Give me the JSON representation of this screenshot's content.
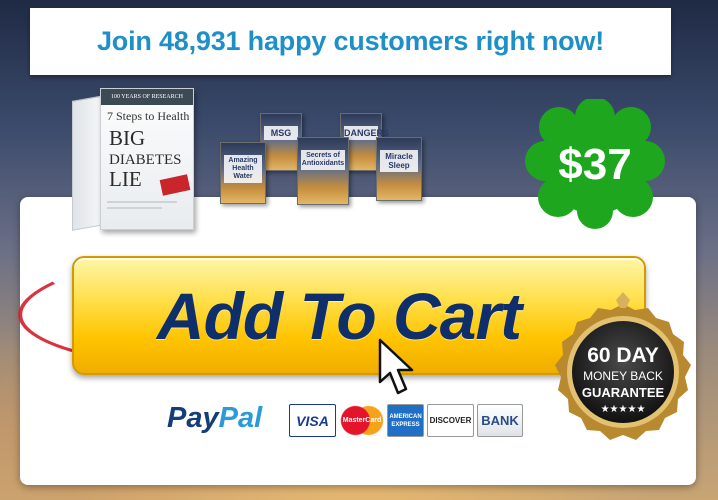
{
  "banner": {
    "text": "Join 48,931 happy customers right now!"
  },
  "main_product": {
    "band_text": "100 YEARS OF RESEARCH",
    "subtitle": "7 Steps to Health",
    "title_lines": [
      "BIG",
      "DIABETES",
      "LIE"
    ]
  },
  "bonus_books": [
    {
      "title": "MSG"
    },
    {
      "title": "DANGERS"
    },
    {
      "title": "Amazing Health Water"
    },
    {
      "title": "Secrets of Antioxidants"
    },
    {
      "title": "Miracle Sleep"
    }
  ],
  "price": {
    "amount": "$37",
    "color": "#1ea71e"
  },
  "cart": {
    "label": "Add To Cart",
    "button_color": "#ffd21c",
    "text_color": "#0f2f6b"
  },
  "guarantee": {
    "days": "60 DAY",
    "line2": "MONEY BACK",
    "line3": "GUARANTEE",
    "stars": "★★★★★"
  },
  "payment": {
    "paypal_a": "Pay",
    "paypal_b": "Pal",
    "cards": [
      "VISA",
      "MasterCard",
      "AMERICAN EXPRESS",
      "DISCOVER",
      "BANK"
    ]
  }
}
